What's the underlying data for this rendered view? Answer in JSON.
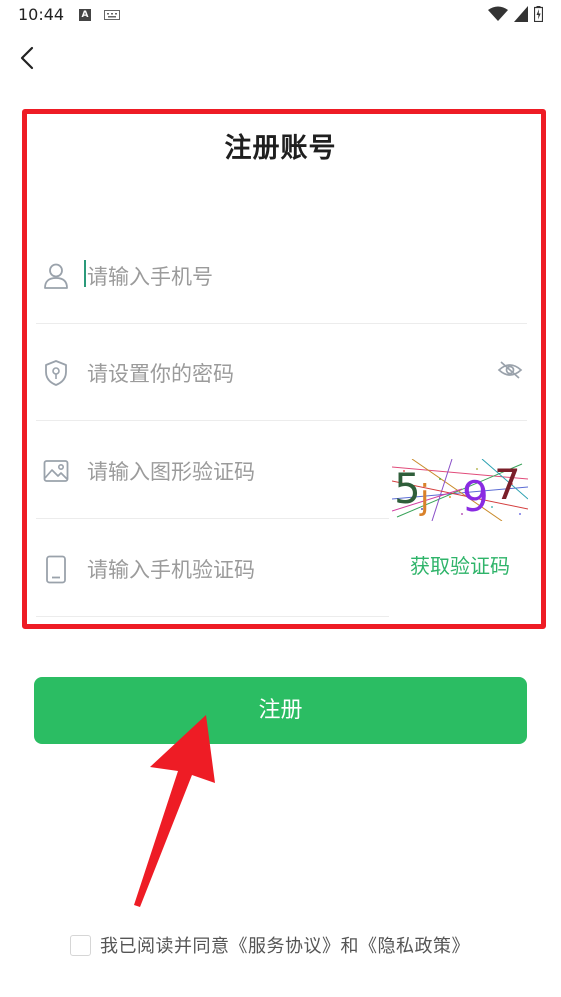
{
  "status_bar": {
    "time": "10:44",
    "notif_letter": "A"
  },
  "page": {
    "title": "注册账号"
  },
  "form": {
    "phone_placeholder": "请输入手机号",
    "password_placeholder": "请设置你的密码",
    "captcha_placeholder": "请输入图形验证码",
    "sms_placeholder": "请输入手机验证码",
    "captcha_text": "5j97",
    "get_code_label": "获取验证码"
  },
  "register_label": "注册",
  "agreement": {
    "text": "我已阅读并同意《服务协议》和《隐私政策》"
  },
  "colors": {
    "accent": "#2bbd63",
    "annotation": "#ee1c25",
    "link": "#2fb46a"
  },
  "icons": {
    "back": "chevron-left-icon",
    "user": "user-icon",
    "password": "shield-lock-icon",
    "captcha": "image-icon",
    "sms": "phone-icon",
    "visibility": "eye-off-icon"
  }
}
